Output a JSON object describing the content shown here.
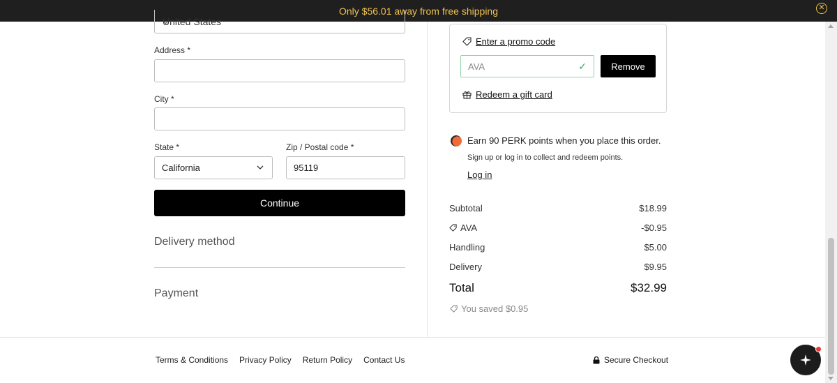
{
  "banner": {
    "prefix": "Only",
    "amount": "$56.01",
    "suffix": "away from free shipping"
  },
  "form": {
    "country_value": "United States",
    "address_label": "Address *",
    "address_value": "",
    "city_label": "City *",
    "city_value": "",
    "state_label": "State *",
    "state_value": "California",
    "zip_label": "Zip / Postal code *",
    "zip_value": "95119",
    "continue_label": "Continue"
  },
  "sections": {
    "delivery": "Delivery method",
    "payment": "Payment"
  },
  "promo": {
    "enter_link": "Enter a promo code",
    "code_value": "AVA",
    "remove_label": "Remove",
    "gift_link": "Redeem a gift card"
  },
  "perk": {
    "earn_text": "Earn 90 PERK points when you place this order.",
    "sub_text": "Sign up or log in to collect and redeem points.",
    "login_link": "Log in"
  },
  "summary": {
    "rows": [
      {
        "label": "Subtotal",
        "value": "$18.99"
      },
      {
        "label": "AVA",
        "value": "-$0.95"
      },
      {
        "label": "Handling",
        "value": "$5.00"
      },
      {
        "label": "Delivery",
        "value": "$9.95"
      }
    ],
    "total_label": "Total",
    "total_value": "$32.99",
    "saved_text": "You saved $0.95"
  },
  "footer": {
    "links": [
      "Terms & Conditions",
      "Privacy Policy",
      "Return Policy",
      "Contact Us"
    ],
    "secure_label": "Secure Checkout"
  },
  "colors": {
    "banner_bg": "#1f1f1f",
    "banner_text": "#f2c14e",
    "valid_border": "#8fd3a8",
    "valid_check": "#3aa565"
  }
}
